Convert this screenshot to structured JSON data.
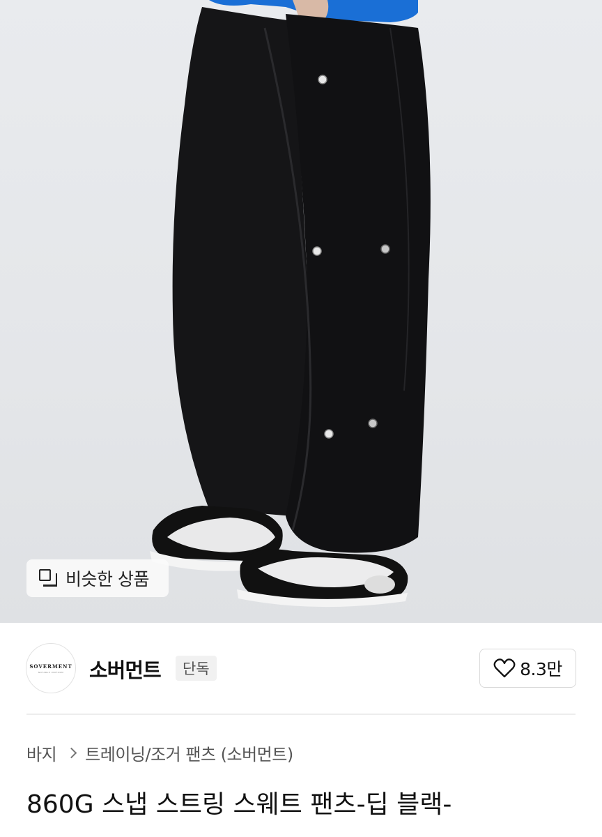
{
  "product_image": {
    "similar_products_label": "비슷한 상품"
  },
  "brand": {
    "logo_text": "SOVERMENT",
    "logo_subtext": "NOTABLE UNIFORM",
    "name": "소버먼트",
    "badge": "단독",
    "like_count": "8.3만"
  },
  "breadcrumb": {
    "category": "바지",
    "subcategory": "트레이닝/조거 팬츠 (소버먼트)"
  },
  "product": {
    "title": "860G 스냅 스트링 스웨트 팬츠-딥 블랙-"
  },
  "colors": {
    "pants": "#141416",
    "sweater": "#1a6fd6",
    "background": "#e6e8eb"
  }
}
